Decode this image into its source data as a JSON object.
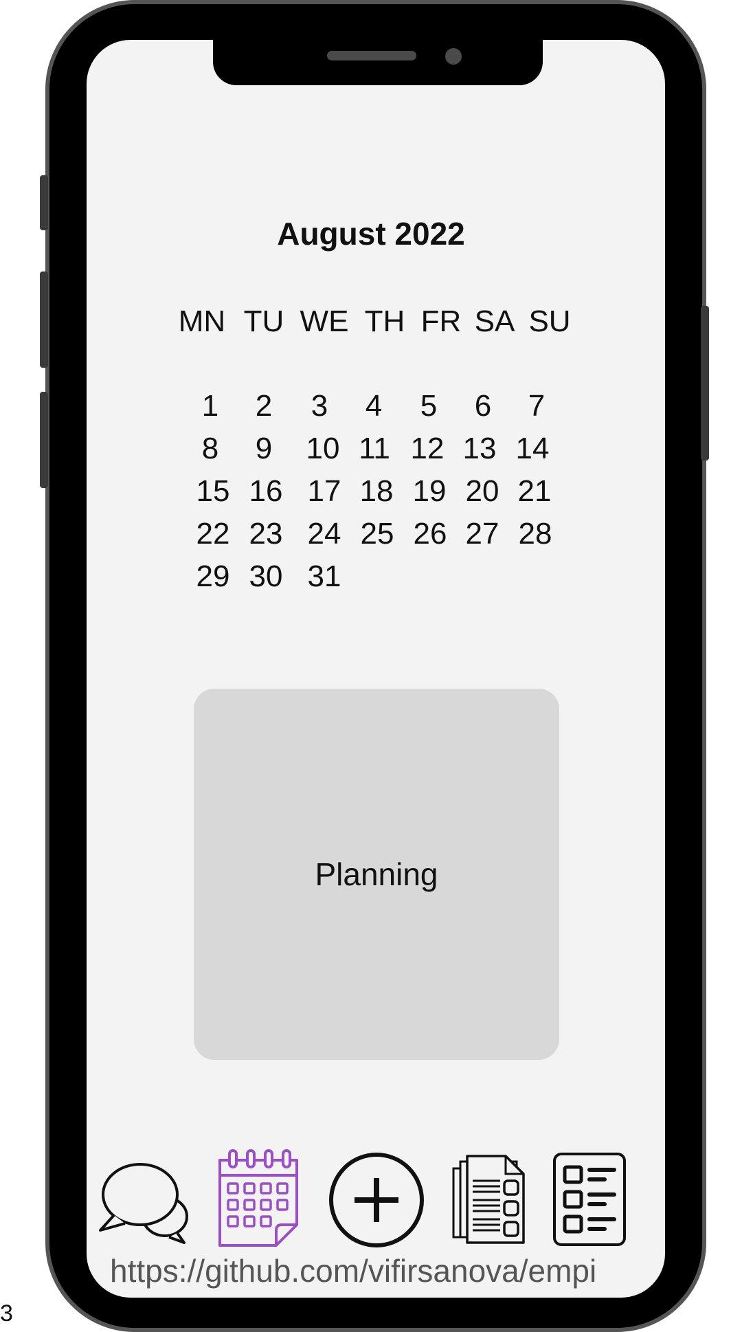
{
  "calendar": {
    "title": "August 2022",
    "weekdays": [
      "MN",
      "TU",
      "WE",
      "TH",
      "FR",
      "SA",
      "SU"
    ],
    "weeks": [
      [
        "1",
        "2",
        "3",
        "4",
        "5",
        "6",
        "7"
      ],
      [
        "8",
        "9",
        "10",
        "11",
        "12",
        "13",
        "14"
      ],
      [
        "15",
        "16",
        "17",
        "18",
        "19",
        "20",
        "21"
      ],
      [
        "22",
        "23",
        "24",
        "25",
        "26",
        "27",
        "28"
      ],
      [
        "29",
        "30",
        "31",
        "",
        "",
        "",
        ""
      ]
    ]
  },
  "planning": {
    "label": "Planning"
  },
  "bottom_nav": {
    "items": [
      {
        "icon": "chat-bubbles-icon"
      },
      {
        "icon": "calendar-icon",
        "active": true,
        "color": "#9b4fc7"
      },
      {
        "icon": "add-circle-icon"
      },
      {
        "icon": "documents-icon"
      },
      {
        "icon": "checklist-icon"
      }
    ]
  },
  "footer": {
    "url": "https://github.com/vifirsanova/empi",
    "page_number": "3"
  }
}
